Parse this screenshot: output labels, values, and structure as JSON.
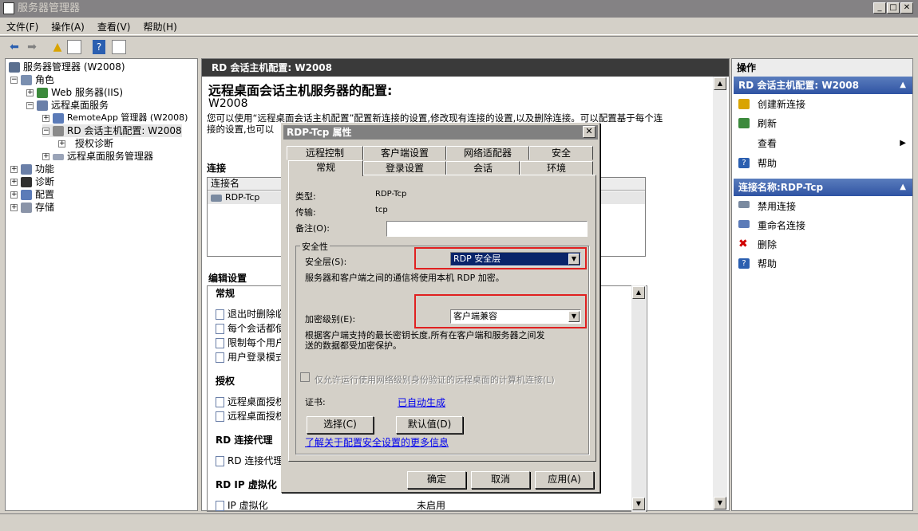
{
  "window": {
    "title": "服务器管理器",
    "minimize": "_",
    "maximize": "□",
    "close": "✕"
  },
  "menu": [
    "文件(F)",
    "操作(A)",
    "查看(V)",
    "帮助(H)"
  ],
  "tree": {
    "root": "服务器管理器 (W2008)",
    "roles": "角色",
    "web": "Web 服务器(IIS)",
    "rds": "远程桌面服务",
    "remoteapp": "RemoteApp 管理器 (W2008)",
    "rdconfig": "RD 会话主机配置: W2008",
    "licdiag": "授权诊断",
    "rdmanager": "远程桌面服务管理器",
    "features": "功能",
    "diagnostics": "诊断",
    "configuration": "配置",
    "storage": "存储"
  },
  "center": {
    "header": "RD 会话主机配置: W2008",
    "title": "远程桌面会话主机服务器的配置:",
    "server": "W2008",
    "desc1": "您可以使用“远程桌面会话主机配置”配置新连接的设置,修改现有连接的设置,以及删除连接。可以配置基于每个连",
    "desc2": "接的设置,也可以",
    "connections_label": "连接",
    "col_name": "连接名",
    "conn_row": "RDP-Tcp",
    "edit_settings": "编辑设置",
    "general": "常规",
    "g1": "退出时删除临",
    "g2": "每个会话都使",
    "g3": "限制每个用户",
    "g4": "用户登录模式",
    "licensing": "授权",
    "l1": "远程桌面授权",
    "l2": "远程桌面授权",
    "broker": "RD 连接代理",
    "b1": "RD 连接代理",
    "ipv": "RD IP 虚拟化",
    "ip1": "IP 虚拟化",
    "ip1_val": "未启用"
  },
  "actions": {
    "header": "操作",
    "sec1": "RD 会话主机配置: W2008",
    "create": "创建新连接",
    "refresh": "刷新",
    "view": "查看",
    "help1": "帮助",
    "sec2": "连接名称:RDP-Tcp",
    "disable": "禁用连接",
    "rename": "重命名连接",
    "delete": "删除",
    "help2": "帮助"
  },
  "dialog": {
    "title": "RDP-Tcp 属性",
    "tabs_back": [
      "远程控制",
      "客户端设置",
      "网络适配器",
      "安全"
    ],
    "tabs_front": [
      "常规",
      "登录设置",
      "会话",
      "环境"
    ],
    "type_label": "类型:",
    "type_val": "RDP-Tcp",
    "transport_label": "传输:",
    "transport_val": "tcp",
    "comment_label": "备注(O):",
    "security_group": "安全性",
    "sec_layer_label": "安全层(S):",
    "sec_layer_val": "RDP 安全层",
    "sec_layer_desc": "服务器和客户端之间的通信将使用本机 RDP 加密。",
    "enc_label": "加密级别(E):",
    "enc_val": "客户端兼容",
    "enc_desc1": "根据客户端支持的最长密钥长度,所有在客户端和服务器之间发",
    "enc_desc2": "送的数据都受加密保护。",
    "nla_label": "仅允许运行使用网络级别身份验证的远程桌面的计算机连接(L)",
    "cert_label": "证书:",
    "cert_val": "已自动生成",
    "select_btn": "选择(C)",
    "default_btn": "默认值(D)",
    "learn_link": "了解关于配置安全设置的更多信息",
    "ok": "确定",
    "cancel": "取消",
    "apply": "应用(A)"
  },
  "colors": {
    "accent": "#2f53a3",
    "highlight": "#0a246a",
    "annotation": "#e02020"
  }
}
